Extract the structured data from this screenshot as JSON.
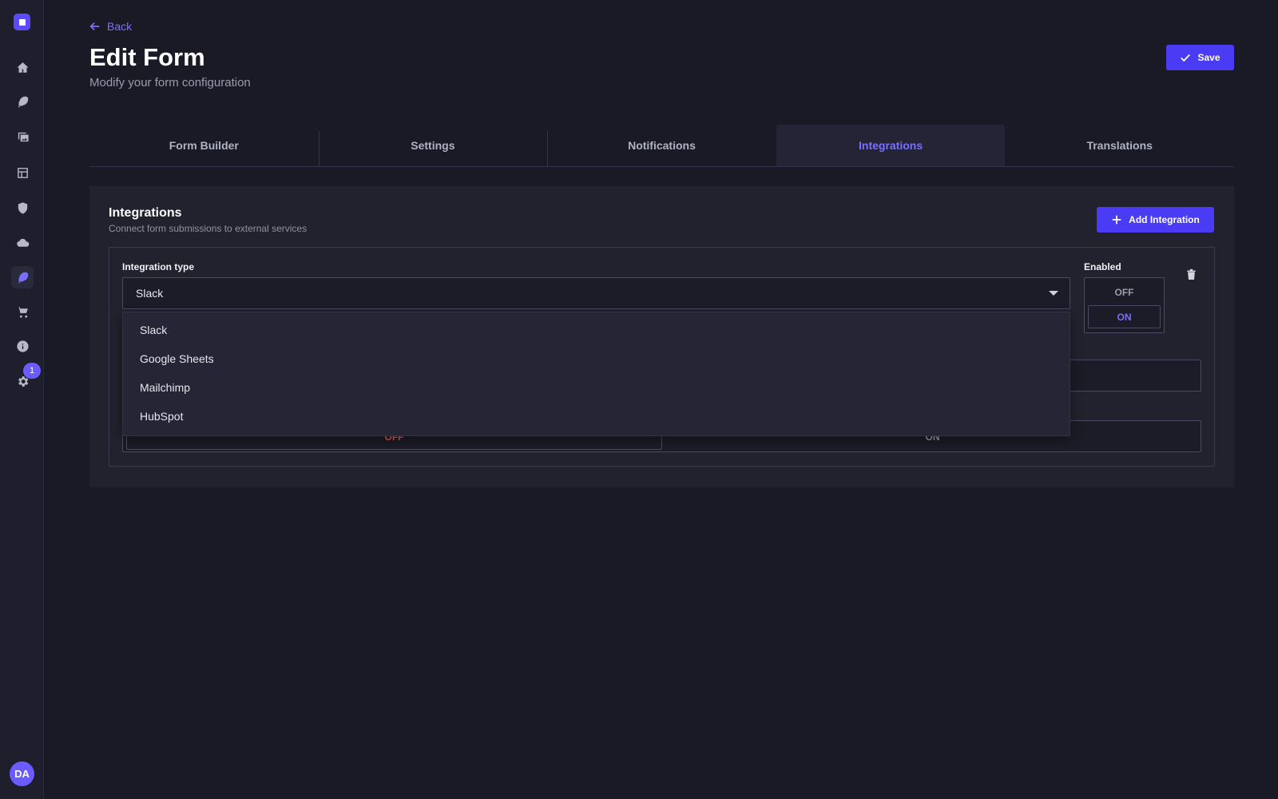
{
  "header": {
    "back_label": "Back",
    "title": "Edit Form",
    "subtitle": "Modify your form configuration",
    "save_label": "Save"
  },
  "tabs": [
    {
      "label": "Form Builder"
    },
    {
      "label": "Settings"
    },
    {
      "label": "Notifications"
    },
    {
      "label": "Integrations",
      "active": true
    },
    {
      "label": "Translations"
    }
  ],
  "sidebar": {
    "icons": [
      "home-icon",
      "feather-icon",
      "images-icon",
      "layout-icon",
      "shield-icon",
      "cloud-icon",
      "feather-active-icon",
      "cart-icon",
      "info-icon",
      "gear-icon"
    ],
    "settings_badge": "1",
    "avatar_initials": "DA"
  },
  "integrations": {
    "title": "Integrations",
    "subtitle": "Connect form submissions to external services",
    "add_label": "Add Integration",
    "card": {
      "type_label": "Integration type",
      "selected_type": "Slack",
      "enabled_label": "Enabled",
      "enabled_off": "OFF",
      "enabled_on": "ON",
      "bottom_off": "OFF",
      "bottom_on": "ON"
    },
    "options": [
      "Slack",
      "Google Sheets",
      "Mailchimp",
      "HubSpot"
    ]
  },
  "colors": {
    "accent": "#4a3cf5",
    "accent_text": "#7b6fff",
    "background": "#1a1a26",
    "off_red": "#e25555"
  }
}
